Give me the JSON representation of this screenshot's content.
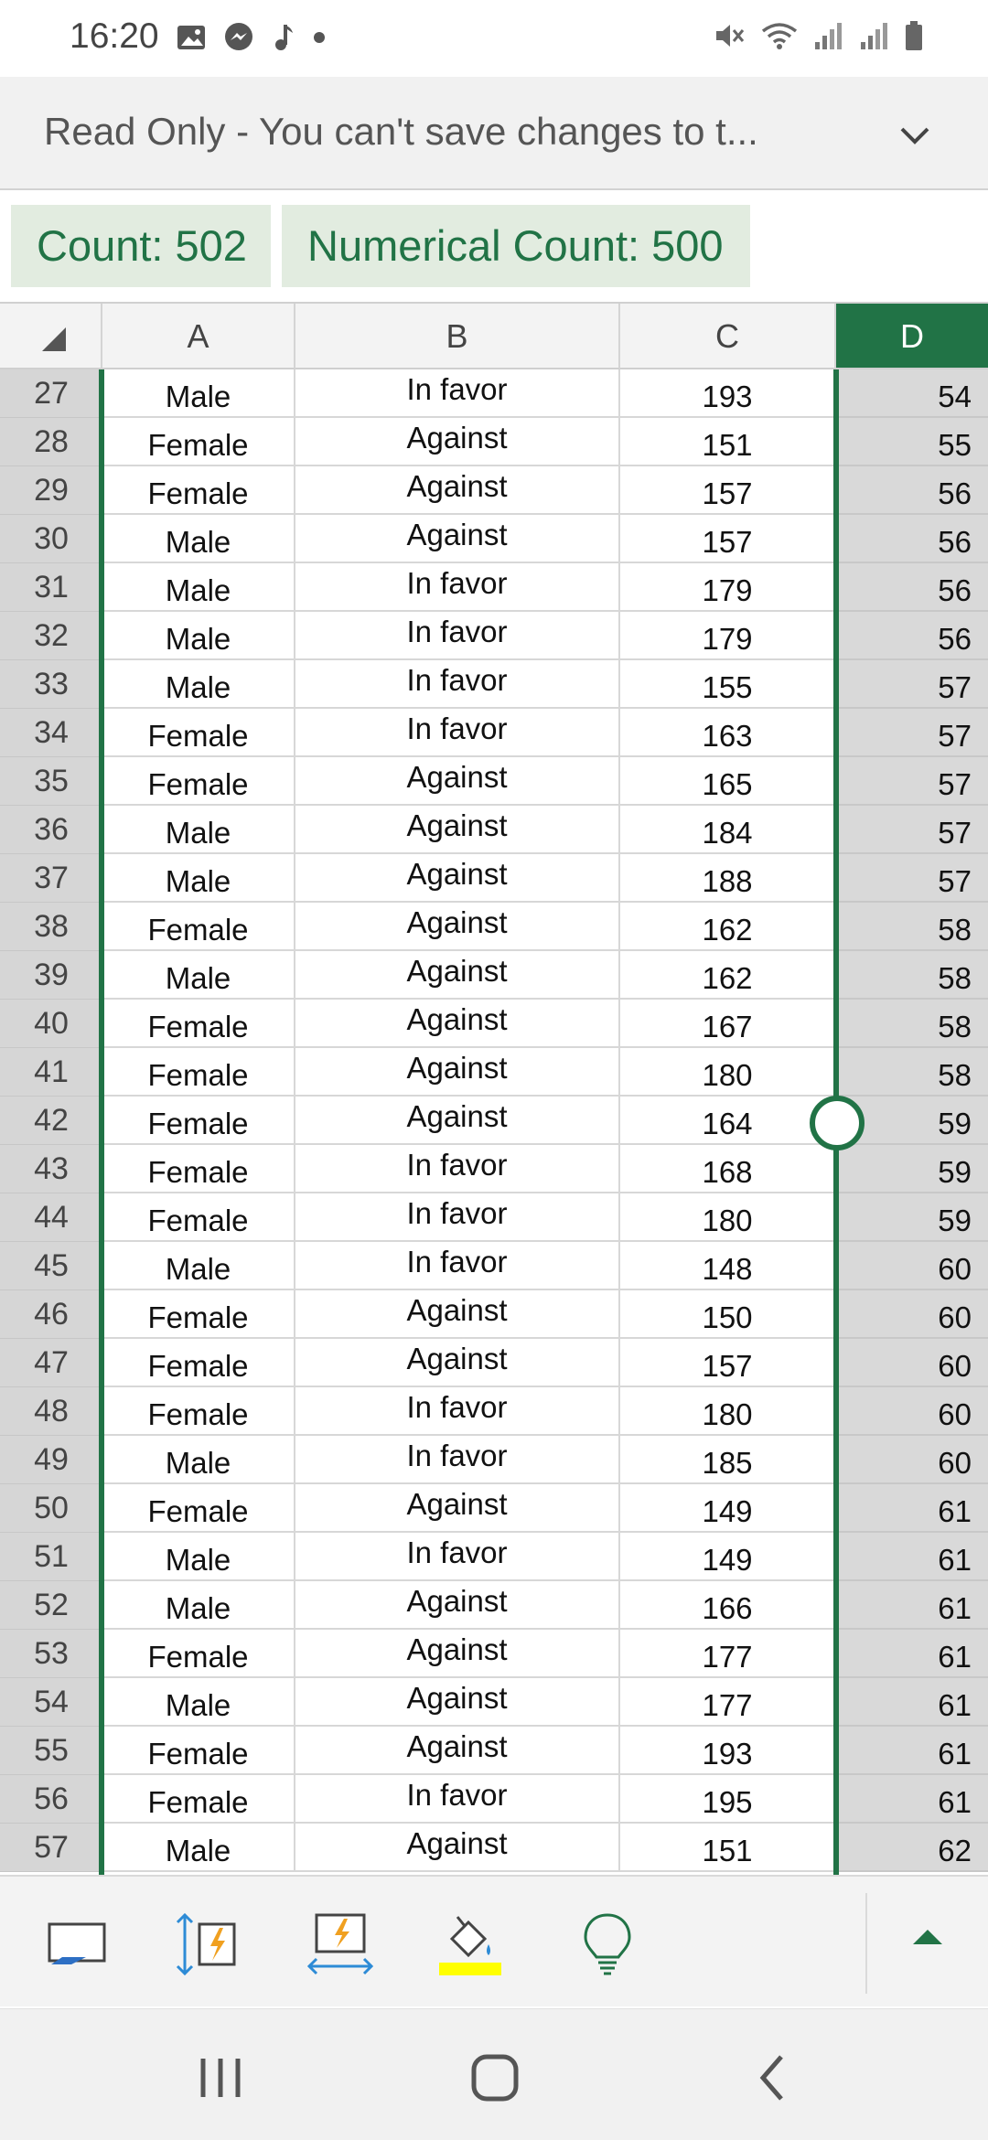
{
  "status": {
    "time": "16:20",
    "left_icons": [
      "image-icon",
      "messenger-icon",
      "music-note-icon",
      "dot-icon"
    ],
    "right_icons": [
      "mute-icon",
      "wifi-icon",
      "signal-icon",
      "signal-icon",
      "battery-icon"
    ]
  },
  "banner": {
    "text": "Read Only - You can't save changes to t...",
    "chevron_icon": "chevron-down-icon"
  },
  "stats": {
    "count": "Count: 502",
    "numerical_count": "Numerical Count: 500"
  },
  "columns": [
    "A",
    "B",
    "C",
    "D"
  ],
  "selected_column": "D",
  "rows": [
    {
      "n": "27",
      "a": "Male",
      "b": "In favor",
      "c": "193",
      "d": "54"
    },
    {
      "n": "28",
      "a": "Female",
      "b": "Against",
      "c": "151",
      "d": "55"
    },
    {
      "n": "29",
      "a": "Female",
      "b": "Against",
      "c": "157",
      "d": "56"
    },
    {
      "n": "30",
      "a": "Male",
      "b": "Against",
      "c": "157",
      "d": "56"
    },
    {
      "n": "31",
      "a": "Male",
      "b": "In favor",
      "c": "179",
      "d": "56"
    },
    {
      "n": "32",
      "a": "Male",
      "b": "In favor",
      "c": "179",
      "d": "56"
    },
    {
      "n": "33",
      "a": "Male",
      "b": "In favor",
      "c": "155",
      "d": "57"
    },
    {
      "n": "34",
      "a": "Female",
      "b": "In favor",
      "c": "163",
      "d": "57"
    },
    {
      "n": "35",
      "a": "Female",
      "b": "Against",
      "c": "165",
      "d": "57"
    },
    {
      "n": "36",
      "a": "Male",
      "b": "Against",
      "c": "184",
      "d": "57"
    },
    {
      "n": "37",
      "a": "Male",
      "b": "Against",
      "c": "188",
      "d": "57"
    },
    {
      "n": "38",
      "a": "Female",
      "b": "Against",
      "c": "162",
      "d": "58"
    },
    {
      "n": "39",
      "a": "Male",
      "b": "Against",
      "c": "162",
      "d": "58"
    },
    {
      "n": "40",
      "a": "Female",
      "b": "Against",
      "c": "167",
      "d": "58"
    },
    {
      "n": "41",
      "a": "Female",
      "b": "Against",
      "c": "180",
      "d": "58"
    },
    {
      "n": "42",
      "a": "Female",
      "b": "Against",
      "c": "164",
      "d": "59"
    },
    {
      "n": "43",
      "a": "Female",
      "b": "In favor",
      "c": "168",
      "d": "59"
    },
    {
      "n": "44",
      "a": "Female",
      "b": "In favor",
      "c": "180",
      "d": "59"
    },
    {
      "n": "45",
      "a": "Male",
      "b": "In favor",
      "c": "148",
      "d": "60"
    },
    {
      "n": "46",
      "a": "Female",
      "b": "Against",
      "c": "150",
      "d": "60"
    },
    {
      "n": "47",
      "a": "Female",
      "b": "Against",
      "c": "157",
      "d": "60"
    },
    {
      "n": "48",
      "a": "Female",
      "b": "In favor",
      "c": "180",
      "d": "60"
    },
    {
      "n": "49",
      "a": "Male",
      "b": "In favor",
      "c": "185",
      "d": "60"
    },
    {
      "n": "50",
      "a": "Female",
      "b": "Against",
      "c": "149",
      "d": "61"
    },
    {
      "n": "51",
      "a": "Male",
      "b": "In favor",
      "c": "149",
      "d": "61"
    },
    {
      "n": "52",
      "a": "Male",
      "b": "Against",
      "c": "166",
      "d": "61"
    },
    {
      "n": "53",
      "a": "Female",
      "b": "Against",
      "c": "177",
      "d": "61"
    },
    {
      "n": "54",
      "a": "Male",
      "b": "Against",
      "c": "177",
      "d": "61"
    },
    {
      "n": "55",
      "a": "Female",
      "b": "Against",
      "c": "193",
      "d": "61"
    },
    {
      "n": "56",
      "a": "Female",
      "b": "In favor",
      "c": "195",
      "d": "61"
    },
    {
      "n": "57",
      "a": "Male",
      "b": "Against",
      "c": "151",
      "d": "62"
    }
  ],
  "toolbar": {
    "icons": [
      "keyboard-icon",
      "autofit-row-height-icon",
      "autofit-column-width-icon",
      "fill-color-icon",
      "lightbulb-icon",
      "expand-up-icon"
    ],
    "fill_color": "#ffff00"
  },
  "navbar": {
    "icons": [
      "recent-apps-icon",
      "home-icon",
      "back-icon"
    ]
  },
  "colors": {
    "accent": "#217346",
    "chip_bg": "#e2ece0"
  }
}
